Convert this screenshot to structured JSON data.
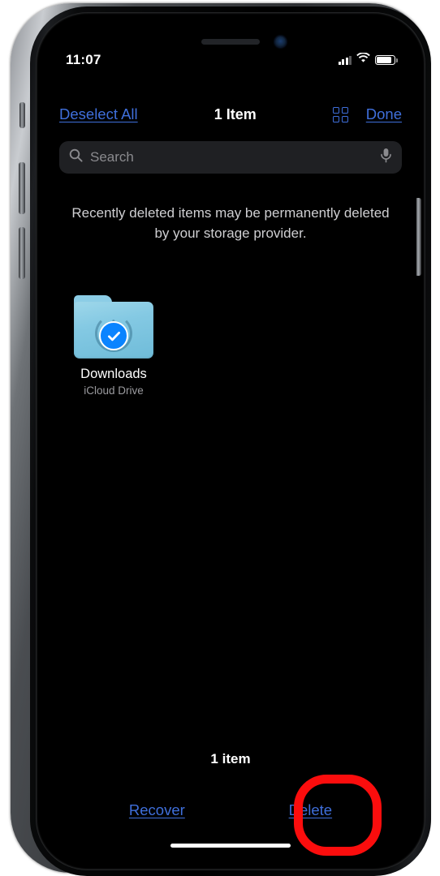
{
  "status_bar": {
    "time": "11:07",
    "cellular_icon": "cellular-signal-icon",
    "wifi_icon": "wifi-icon",
    "battery_icon": "battery-icon",
    "battery_level_percent": 88
  },
  "nav_bar": {
    "left_button": "Deselect All",
    "title": "1 Item",
    "grid_view_icon": "grid-view-icon",
    "right_button": "Done"
  },
  "search": {
    "placeholder": "Search",
    "search_icon": "search-icon",
    "microphone_icon": "microphone-icon"
  },
  "notice": {
    "text": "Recently deleted items may be permanently deleted by your storage provider."
  },
  "files": [
    {
      "name": "Downloads",
      "source": "iCloud Drive",
      "icon": "folder-download-icon",
      "selected": true,
      "badge_icon": "checkmark-badge-icon"
    }
  ],
  "footer": {
    "item_count_label": "1 item",
    "recover_button": "Recover",
    "delete_button": "Delete"
  },
  "annotation": {
    "shape": "rounded-rectangle-highlight",
    "target": "Delete",
    "color": "#fb0d0d"
  },
  "colors": {
    "link_blue": "#3f6fdb",
    "badge_blue": "#0a84ff",
    "folder_blue": "#84c9e3",
    "screen_background": "#000000",
    "search_background": "#1f2023",
    "annotation_red": "#fb0d0d"
  }
}
